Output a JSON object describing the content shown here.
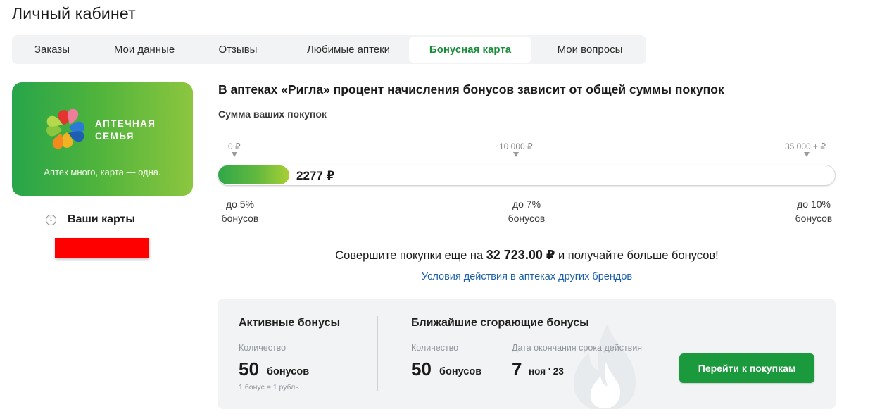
{
  "page": {
    "title": "Личный кабинет"
  },
  "tabs": [
    {
      "label": "Заказы"
    },
    {
      "label": "Мои данные"
    },
    {
      "label": "Отзывы"
    },
    {
      "label": "Любимые аптеки"
    },
    {
      "label": "Бонусная карта",
      "active": true
    },
    {
      "label": "Мои вопросы"
    }
  ],
  "card": {
    "brand_line1": "АПТЕЧНАЯ",
    "brand_line2": "СЕМЬЯ",
    "slogan": "Аптек много, карта — одна.",
    "logo_icon": "pharmacy-family-logo-icon",
    "colors": {
      "gradient_start": "#27a54a",
      "gradient_end": "#8cc63f"
    }
  },
  "sidebar": {
    "cards_label": "Ваши карты",
    "info_icon": "info-icon",
    "info_glyph": "i"
  },
  "bonus": {
    "headline": "В аптеках «Ригла» процент начисления бонусов зависит от общей суммы покупок",
    "sum_label": "Сумма ваших покупок",
    "scale": {
      "ticks": [
        "0 ₽",
        "10 000 ₽",
        "35 000 + ₽"
      ],
      "levels": [
        {
          "percent": "до 5%",
          "word": "бонусов"
        },
        {
          "percent": "до 7%",
          "word": "бонусов"
        },
        {
          "percent": "до 10%",
          "word": "бонусов"
        }
      ]
    },
    "progress": {
      "current_text": "2277 ₽",
      "fraction": 0.115
    },
    "promo_before": "Совершите покупки еще на ",
    "promo_amount": "32 723.00 ₽",
    "promo_after": " и получайте больше бонусов!",
    "conditions_link": "Условия действия в аптеках других брендов"
  },
  "active_bonuses": {
    "title": "Активные бонусы",
    "qty_label": "Количество",
    "qty_value": "50",
    "qty_unit": "бонусов",
    "note": "1 бонус = 1 рубль"
  },
  "expiring_bonuses": {
    "title": "Ближайшие сгорающие бонусы",
    "qty_label": "Количество",
    "qty_value": "50",
    "qty_unit": "бонусов",
    "date_label": "Дата окончания срока действия",
    "date_day": "7",
    "date_month": "ноя ' 23",
    "decor_icon": "flame-icon"
  },
  "actions": {
    "go_shopping": "Перейти к покупкам"
  },
  "colors": {
    "accent": "#1a9a3d",
    "link": "#1b5fa8",
    "redaction": "#ff0000"
  }
}
